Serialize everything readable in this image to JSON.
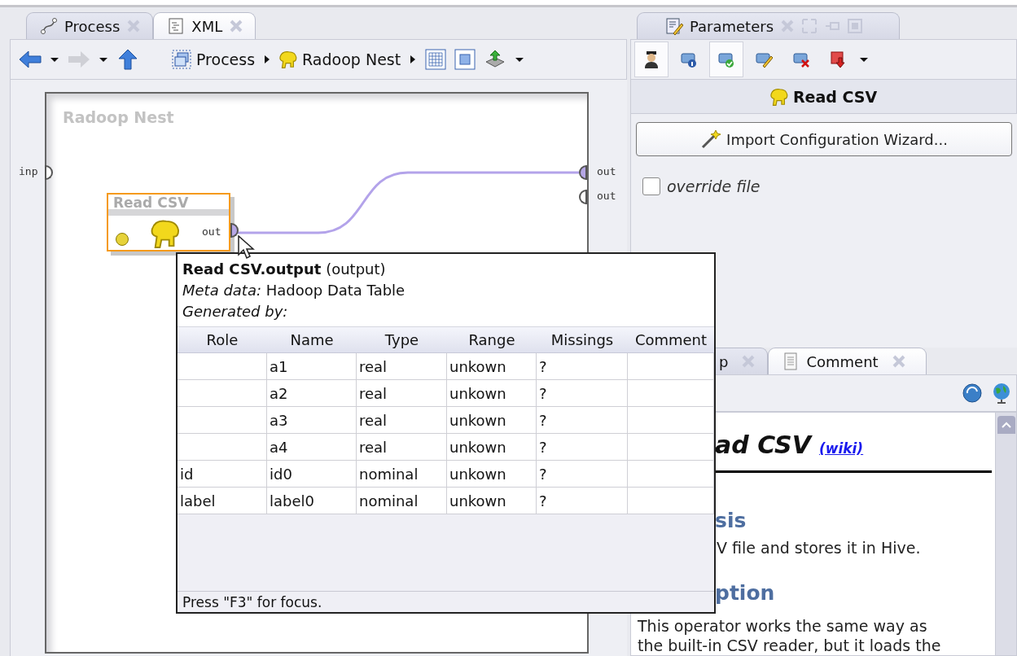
{
  "editor": {
    "tabs": [
      {
        "label": "Process",
        "kind": "process",
        "selected": true
      },
      {
        "label": "XML",
        "kind": "xml",
        "selected": false
      }
    ],
    "breadcrumb": [
      {
        "label": "Process",
        "kind": "process"
      },
      {
        "label": "Radoop Nest",
        "kind": "elephant"
      }
    ],
    "canvas": {
      "subprocess_title": "Radoop Nest",
      "input_ports": [
        {
          "label": "inp",
          "connected": false
        }
      ],
      "output_ports": [
        {
          "label": "out",
          "connected": true
        },
        {
          "label": "out",
          "connected": false
        }
      ],
      "operator": {
        "name": "Read CSV",
        "port": "out",
        "selected": true
      }
    }
  },
  "parameters": {
    "tab": {
      "label": "Parameters",
      "selected": true
    },
    "mode_buttons": [
      {
        "kind": "expert",
        "selected": true
      },
      {
        "kind": "info",
        "selected": false
      },
      {
        "kind": "validate",
        "selected": true
      },
      {
        "kind": "edit",
        "selected": false
      },
      {
        "kind": "delete",
        "selected": false
      },
      {
        "kind": "import",
        "selected": false
      }
    ],
    "operator_title": "Read CSV",
    "wizard_button": "Import Configuration Wizard...",
    "override_file": {
      "label": "override file",
      "checked": false
    }
  },
  "help": {
    "tabs": [
      {
        "label": "p",
        "kind": "help",
        "selected": true
      },
      {
        "label": "Comment",
        "kind": "comment",
        "selected": false
      }
    ],
    "heading": "ad CSV",
    "wiki_link": "(wiki)",
    "sections": [
      {
        "kind": "title",
        "text": "sis"
      },
      {
        "kind": "text",
        "text": "V file and stores it in Hive."
      },
      {
        "kind": "title",
        "text": "ption"
      },
      {
        "kind": "paragraph",
        "text": "This operator works the same way as"
      },
      {
        "kind": "paragraph",
        "text": "the built-in CSV reader, but it loads the"
      }
    ]
  },
  "tooltip": {
    "title": "**Read CSV.output** (output)",
    "meta": "*Meta data:* Hadoop Data Table",
    "generated": "Generated by:",
    "columns": [
      "Role",
      "Name",
      "Type",
      "Range",
      "Missings",
      "Comment"
    ],
    "rows": [
      [
        "",
        "a1",
        "real",
        "unkown",
        "?",
        ""
      ],
      [
        "",
        "a2",
        "real",
        "unkown",
        "?",
        ""
      ],
      [
        "",
        "a3",
        "real",
        "unkown",
        "?",
        ""
      ],
      [
        "",
        "a4",
        "real",
        "unkown",
        "?",
        ""
      ],
      [
        "id",
        "id0",
        "nominal",
        "unkown",
        "?",
        ""
      ],
      [
        "label",
        "label0",
        "nominal",
        "unkown",
        "?",
        ""
      ]
    ],
    "footer": "Press \"F3\" for focus."
  }
}
